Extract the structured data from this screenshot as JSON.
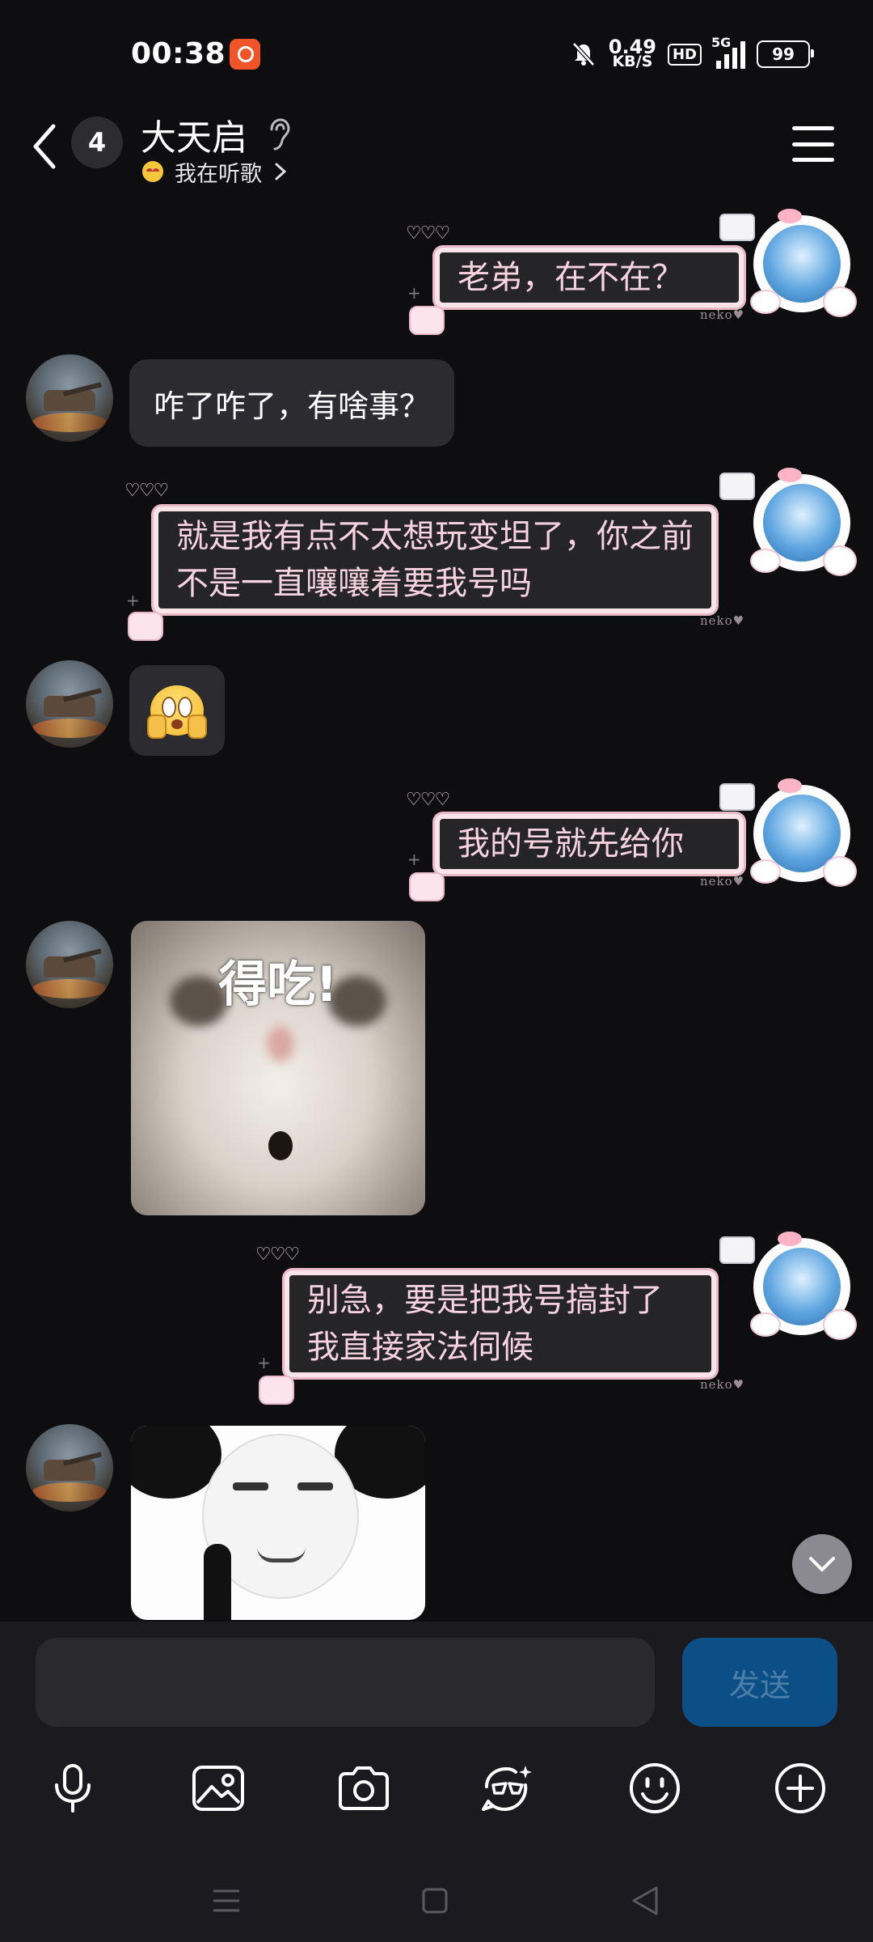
{
  "status_bar": {
    "time": "00:38",
    "net_speed": "0.49",
    "net_unit": "KB/S",
    "hd_label": "HD",
    "network_type": "5G",
    "battery": "99"
  },
  "header": {
    "back_icon": "chevron-left-icon",
    "unread_count": "4",
    "contact_name": "大天启",
    "status_text": "我在听歌",
    "menu_icon": "hamburger-menu-icon"
  },
  "messages": [
    {
      "side": "out",
      "text": "老弟，在不在？"
    },
    {
      "side": "in",
      "text": "咋了咋了，有啥事？"
    },
    {
      "side": "out",
      "text": "就是我有点不太想玩变坦了，你之前不是一直嚷嚷着要我号吗"
    },
    {
      "side": "in",
      "type": "emoji",
      "emoji": "flustered-face-icon"
    },
    {
      "side": "out",
      "text": "我的号就先给你"
    },
    {
      "side": "in",
      "type": "sticker",
      "caption": "得吃!"
    },
    {
      "side": "out",
      "text": "别急，要是把我号搞封了我直接家法伺候"
    },
    {
      "side": "in",
      "type": "sticker",
      "sticker": "panda-meme"
    }
  ],
  "bubble_deco": {
    "neko": "neko♥",
    "hearts": "♡♡♡"
  },
  "composer": {
    "input_value": "",
    "send_label": "发送"
  },
  "colors": {
    "background": "#0e0e11",
    "incoming_bubble": "#2c2c30",
    "outgoing_bubble": "#252528",
    "outgoing_border": "#f9e4ea",
    "send_button": "#0b4f86"
  }
}
